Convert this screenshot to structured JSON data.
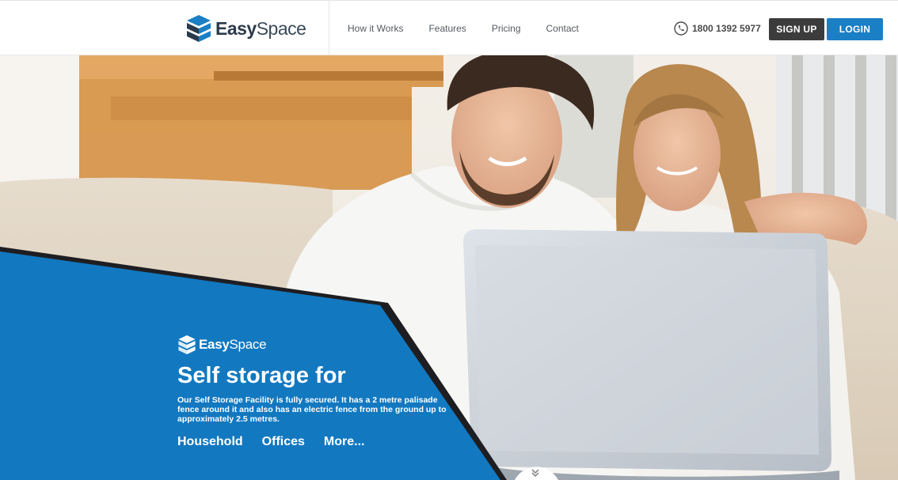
{
  "brand": {
    "name_bold": "Easy",
    "name_light": "Space"
  },
  "nav": {
    "items": [
      {
        "label": "How it Works"
      },
      {
        "label": "Features"
      },
      {
        "label": "Pricing"
      },
      {
        "label": "Contact"
      }
    ]
  },
  "header": {
    "phone": "1800 1392 5977",
    "phone_icon": "phone-icon",
    "signup_label": "SIGN UP",
    "login_label": "LOGIN"
  },
  "hero": {
    "title": "Self storage for",
    "description": "Our Self Storage Facility is fully secured. It has a 2 metre palisade fence around it and also has an electric fence from the ground up to approximately 2.5 metres.",
    "links": [
      {
        "label": "Household"
      },
      {
        "label": "Offices"
      },
      {
        "label": "More..."
      }
    ],
    "scroll_icon": "chevron-down-icon"
  },
  "colors": {
    "brand_blue": "#1a7fc5",
    "brand_dark": "#3c3c3c",
    "hero_panel": "#1278c0"
  }
}
